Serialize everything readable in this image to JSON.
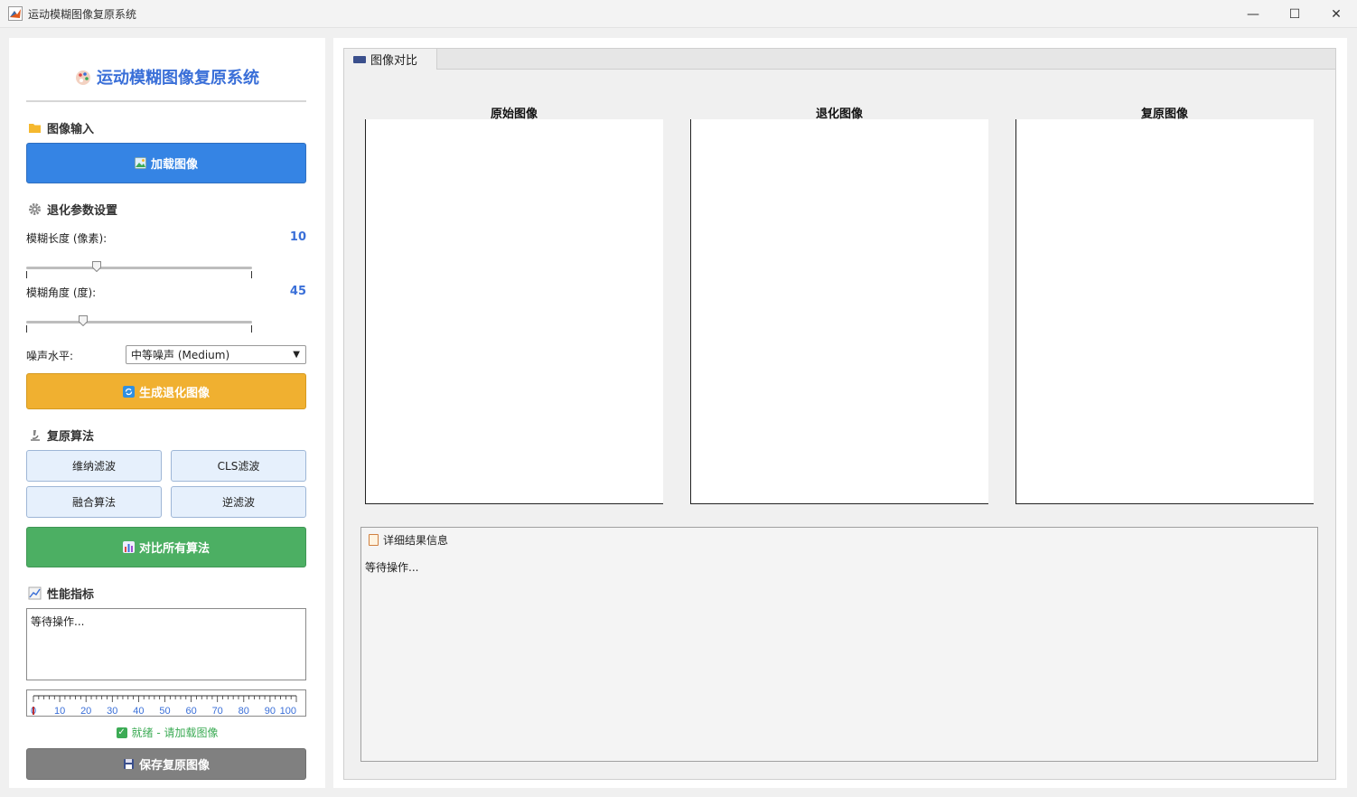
{
  "window": {
    "title": "运动模糊图像复原系统",
    "controls": {
      "minimize": "—",
      "maximize": "☐",
      "close": "✕"
    }
  },
  "sidebar": {
    "heading": "运动模糊图像复原系统",
    "input_section": {
      "title": "图像输入",
      "load_button": "加载图像"
    },
    "params_section": {
      "title": "退化参数设置",
      "blur_length": {
        "label": "模糊长度 (像素):",
        "value": "10",
        "level": 0.31
      },
      "blur_angle": {
        "label": "模糊角度 (度):",
        "value": "45",
        "level": 0.25
      },
      "noise": {
        "label": "噪声水平:",
        "selected": "中等噪声 (Medium)"
      },
      "generate_button": "生成退化图像"
    },
    "algorithm_section": {
      "title": "复原算法",
      "buttons": [
        "维纳滤波",
        "CLS滤波",
        "融合算法",
        "逆滤波"
      ],
      "compare_button": "对比所有算法"
    },
    "metrics_section": {
      "title": "性能指标",
      "text": "等待操作...",
      "gauge_labels": [
        "0",
        "10",
        "20",
        "30",
        "40",
        "50",
        "60",
        "70",
        "80",
        "90",
        "100"
      ],
      "gauge_value": 0
    },
    "status": "就绪 - 请加载图像",
    "save_button": "保存复原图像"
  },
  "main": {
    "tab_label": "图像对比",
    "panels": [
      {
        "title": "原始图像"
      },
      {
        "title": "退化图像"
      },
      {
        "title": "复原图像"
      }
    ],
    "results": {
      "title": "详细结果信息",
      "text": "等待操作..."
    }
  },
  "colors": {
    "accent": "#3a6fd8",
    "primary_button": "#3584e4",
    "warn_button": "#f0b030",
    "green_button": "#4caf63",
    "grey_button": "#808080",
    "status_green": "#3cab55"
  }
}
